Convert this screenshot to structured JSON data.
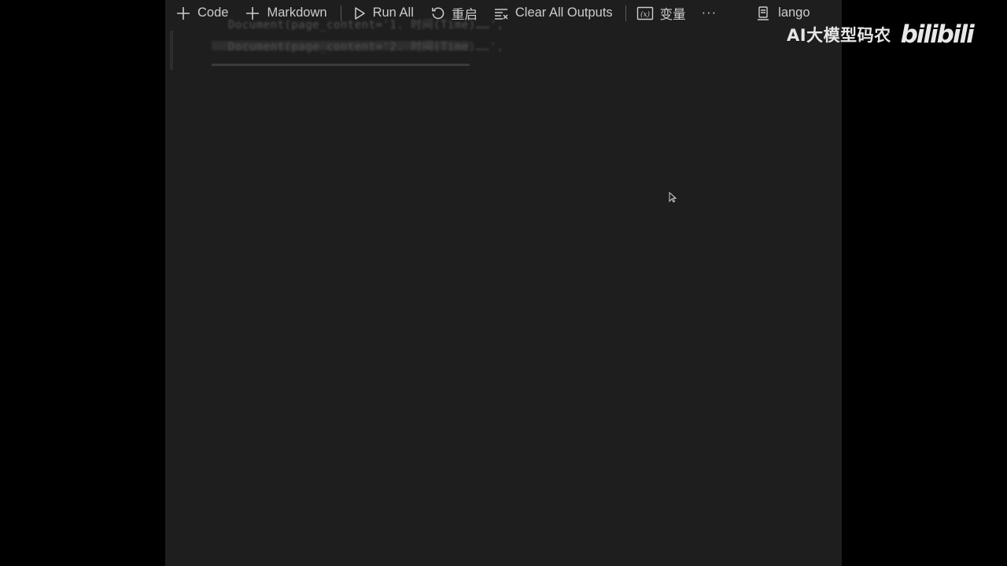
{
  "toolbar": {
    "code_label": "Code",
    "markdown_label": "Markdown",
    "run_all_label": "Run All",
    "restart_label": "重启",
    "clear_outputs_label": "Clear All Outputs",
    "variables_label": "变量",
    "more_label": "···",
    "kernel_label": "lango"
  },
  "output": {
    "line1": "Document(page_content='1. 时间(Time)……',",
    "line2": "Document(page_content='2. 时间(Time)……',"
  },
  "watermark": {
    "text": "AI大模型码农",
    "logo": "bilibili"
  },
  "icons": {
    "add": "plus-icon",
    "run": "play-icon",
    "restart": "restart-icon",
    "clear": "clear-outputs-icon",
    "variables": "variables-icon",
    "kernel": "kernel-icon",
    "cursor": "mouse-pointer-icon"
  }
}
